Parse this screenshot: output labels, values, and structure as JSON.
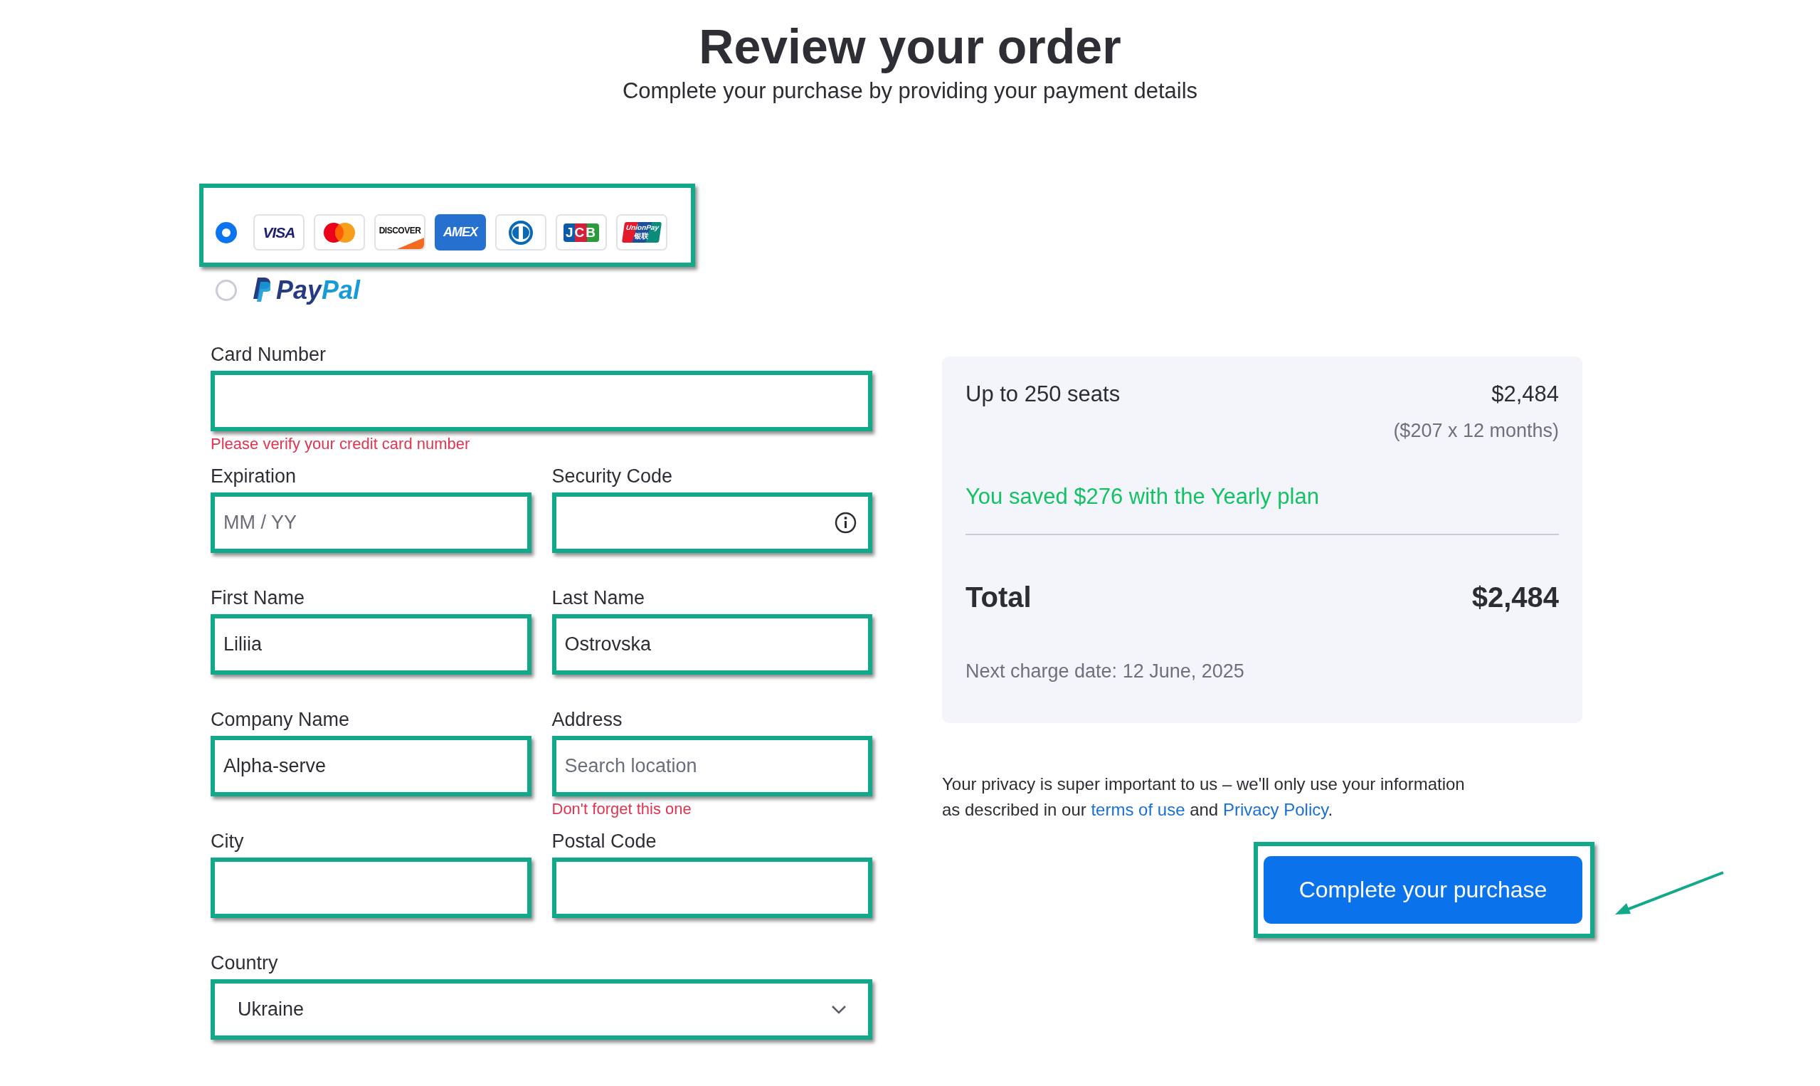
{
  "header": {
    "title": "Review your order",
    "subtitle": "Complete your purchase by providing your payment details"
  },
  "payment_methods": [
    {
      "kind": "cards",
      "selected": true,
      "logos": [
        {
          "kind": "visa",
          "text": "VISA"
        },
        {
          "kind": "mastercard"
        },
        {
          "kind": "discover",
          "text": "DISCOVER"
        },
        {
          "kind": "amex",
          "text": "AMEX"
        },
        {
          "kind": "diners"
        },
        {
          "kind": "jcb",
          "text": "JCB"
        },
        {
          "kind": "unionpay",
          "text": "UnionPay",
          "subtext": "银联"
        }
      ]
    },
    {
      "kind": "paypal",
      "selected": false,
      "text": "PayPal"
    }
  ],
  "form_rows": [
    [
      {
        "label": "Card Number",
        "kind": "text",
        "error": "Please verify your credit card number"
      }
    ],
    [
      {
        "label": "Expiration",
        "kind": "text",
        "placeholder": "MM / YY"
      },
      {
        "label": "Security Code",
        "kind": "info"
      }
    ],
    [
      {
        "label": "First Name",
        "kind": "text",
        "value": "Liliia"
      },
      {
        "label": "Last Name",
        "kind": "text",
        "value": "Ostrovska"
      }
    ],
    [
      {
        "label": "Company Name",
        "kind": "text",
        "value": "Alpha-serve"
      },
      {
        "label": "Address",
        "kind": "text",
        "placeholder": "Search location",
        "error": "Don't forget this one"
      }
    ],
    [
      {
        "label": "City",
        "kind": "text"
      },
      {
        "label": "Postal Code",
        "kind": "text"
      }
    ],
    [
      {
        "label": "Country",
        "kind": "select",
        "value": "Ukraine"
      }
    ]
  ],
  "summary": {
    "plan": "Up to 250 seats",
    "plan_price": "$2,484",
    "plan_detail": "($207 x 12 months)",
    "savings": "You saved $276 with the Yearly plan",
    "total_label": "Total",
    "total_price": "$2,484",
    "next_charge": "Next charge date: 12 June, 2025"
  },
  "privacy_note": {
    "parts": [
      {
        "kind": "text",
        "text": "Your privacy is super important to us – we'll only use your information\nas described in our "
      },
      {
        "kind": "link",
        "text": "terms of use"
      },
      {
        "kind": "text",
        "text": " and "
      },
      {
        "kind": "link",
        "text": "Privacy Policy"
      },
      {
        "kind": "text",
        "text": "."
      }
    ]
  },
  "purchase_button": "Complete your purchase"
}
